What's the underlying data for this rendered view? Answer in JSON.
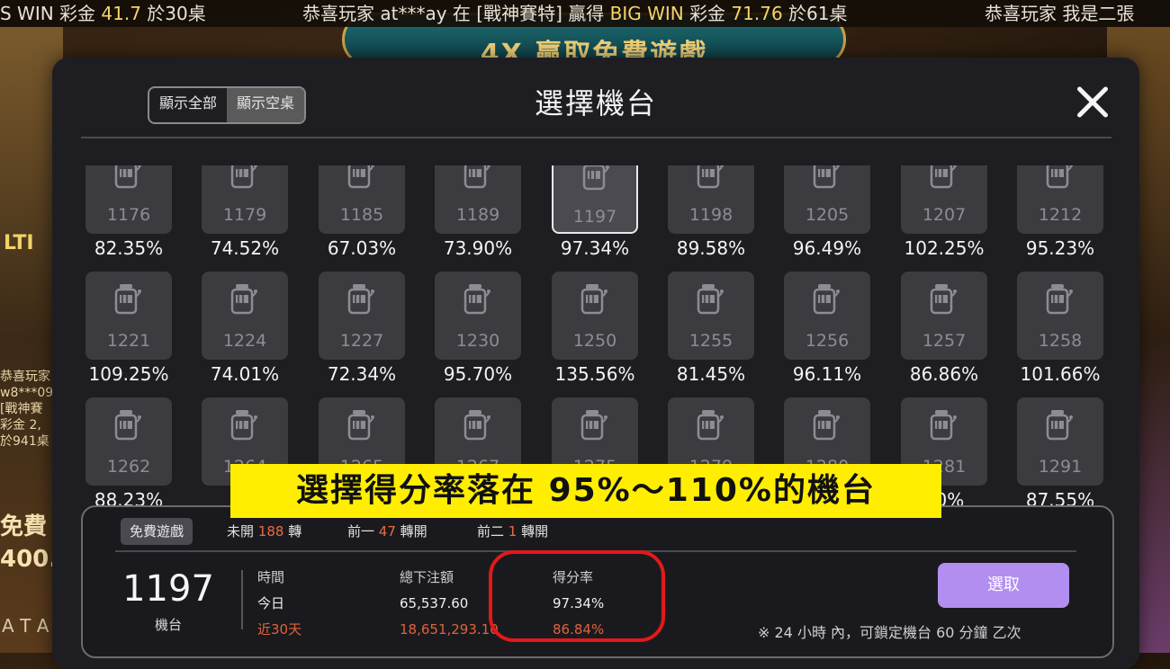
{
  "ticker": {
    "left_prefix": "S WIN 彩金",
    "left_amount": "41.7",
    "left_suffix": "於30桌",
    "mid_prefix": "恭喜玩家 at***ay 在 [戰神賽特] 贏得",
    "mid_big": "BIG WIN",
    "mid_mid": "彩金",
    "mid_amount": "71.76",
    "mid_suffix": "於61桌",
    "right_text": "恭喜玩家 我是二張"
  },
  "background": {
    "banner": "4X 贏取免費遊戲",
    "side_lines": [
      "恭喜玩家",
      "w8***09",
      "[戰神賽",
      "彩金 2,",
      "於941桌"
    ],
    "free_label": "免費",
    "free_amount": "400.",
    "logo": "ATA",
    "side_title": "LTI"
  },
  "dialog": {
    "title": "選擇機台",
    "filter_all": "顯示全部",
    "filter_empty": "顯示空桌",
    "selected_filter": "顯示空桌"
  },
  "machines": [
    {
      "id": "1176",
      "rate": "82.35%"
    },
    {
      "id": "1179",
      "rate": "74.52%"
    },
    {
      "id": "1185",
      "rate": "67.03%"
    },
    {
      "id": "1189",
      "rate": "73.90%"
    },
    {
      "id": "1197",
      "rate": "97.34%",
      "selected": true
    },
    {
      "id": "1198",
      "rate": "89.58%"
    },
    {
      "id": "1205",
      "rate": "96.49%"
    },
    {
      "id": "1207",
      "rate": "102.25%"
    },
    {
      "id": "1212",
      "rate": "95.23%"
    },
    {
      "id": "1221",
      "rate": "109.25%"
    },
    {
      "id": "1224",
      "rate": "74.01%"
    },
    {
      "id": "1227",
      "rate": "72.34%"
    },
    {
      "id": "1230",
      "rate": "95.70%"
    },
    {
      "id": "1250",
      "rate": "135.56%"
    },
    {
      "id": "1255",
      "rate": "81.45%"
    },
    {
      "id": "1256",
      "rate": "96.11%"
    },
    {
      "id": "1257",
      "rate": "86.86%"
    },
    {
      "id": "1258",
      "rate": "101.66%"
    },
    {
      "id": "1262",
      "rate": "88.23%"
    },
    {
      "id": "1264",
      "rate": "96"
    },
    {
      "id": "1265",
      "rate": ""
    },
    {
      "id": "1267",
      "rate": ""
    },
    {
      "id": "1275",
      "rate": ""
    },
    {
      "id": "1279",
      "rate": ""
    },
    {
      "id": "1280",
      "rate": ""
    },
    {
      "id": "1281",
      "rate": "50%"
    },
    {
      "id": "1291",
      "rate": "87.55%"
    }
  ],
  "caption": "選擇得分率落在  95%～110%的機台",
  "detail": {
    "free_game": "免費遊戲",
    "stats": [
      {
        "pre": "未開",
        "n": "188",
        "post": "轉"
      },
      {
        "pre": "前一",
        "n": "47",
        "post": "轉開"
      },
      {
        "pre": "前二",
        "n": "1",
        "post": "轉開"
      }
    ],
    "machine_no": "1197",
    "machine_label": "機台",
    "col_time": {
      "h": "時間",
      "today": "今日",
      "month": "近30天"
    },
    "col_bet": {
      "h": "總下注額",
      "today": "65,537.60",
      "month": "18,651,293.10"
    },
    "col_rate": {
      "h": "得分率",
      "today": "97.34%",
      "month": "86.84%"
    },
    "select_button": "選取",
    "note": "※ 24 小時 內，可鎖定機台 60 分鐘 乙次"
  },
  "colors": {
    "accent": "#b28ef0",
    "highlight": "#ffee00",
    "red": "#e31919",
    "stat_num": "#e96b45"
  }
}
